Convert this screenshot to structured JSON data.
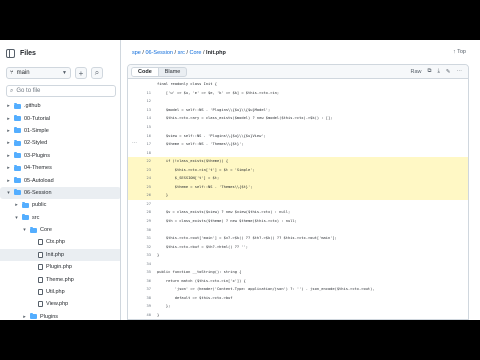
{
  "sidebar": {
    "title": "Files",
    "branch": "main",
    "search_placeholder": "Go to file",
    "tree": [
      {
        "label": ".github",
        "kind": "folder",
        "depth": 0,
        "expanded": false
      },
      {
        "label": "00-Tutorial",
        "kind": "folder",
        "depth": 0,
        "expanded": false
      },
      {
        "label": "01-Simple",
        "kind": "folder",
        "depth": 0,
        "expanded": false
      },
      {
        "label": "02-Styled",
        "kind": "folder",
        "depth": 0,
        "expanded": false
      },
      {
        "label": "03-Plugins",
        "kind": "folder",
        "depth": 0,
        "expanded": false
      },
      {
        "label": "04-Themes",
        "kind": "folder",
        "depth": 0,
        "expanded": false
      },
      {
        "label": "05-Autoload",
        "kind": "folder",
        "depth": 0,
        "expanded": false
      },
      {
        "label": "06-Session",
        "kind": "folder",
        "depth": 0,
        "expanded": true,
        "active": true
      },
      {
        "label": "public",
        "kind": "folder",
        "depth": 1,
        "expanded": false
      },
      {
        "label": "src",
        "kind": "folder",
        "depth": 1,
        "expanded": true
      },
      {
        "label": "Core",
        "kind": "folder",
        "depth": 2,
        "expanded": true
      },
      {
        "label": "Ctx.php",
        "kind": "file",
        "depth": 3
      },
      {
        "label": "Init.php",
        "kind": "file",
        "depth": 3,
        "selected": true
      },
      {
        "label": "Plugin.php",
        "kind": "file",
        "depth": 3
      },
      {
        "label": "Theme.php",
        "kind": "file",
        "depth": 3
      },
      {
        "label": "Util.php",
        "kind": "file",
        "depth": 3
      },
      {
        "label": "View.php",
        "kind": "file",
        "depth": 3
      },
      {
        "label": "Plugins",
        "kind": "folder",
        "depth": 2,
        "expanded": false
      }
    ]
  },
  "breadcrumb": {
    "parts": [
      "spe",
      "06-Session",
      "src",
      "Core"
    ],
    "current": "Init.php",
    "top_label": "Top"
  },
  "file_header": {
    "tab_code": "Code",
    "tab_blame": "Blame",
    "raw_label": "Raw"
  },
  "code": [
    {
      "n": "",
      "t": "final readonly class Init {"
    },
    {
      "n": "11",
      "t": "    ['u' => $u, 'e' => $e, 'k' => $k] = $this->ctx->in;"
    },
    {
      "n": "12",
      "t": ""
    },
    {
      "n": "13",
      "t": "    $model = self::NS . 'Plugins\\\\{$u}\\\\{$u}Model';"
    },
    {
      "n": "14",
      "t": "    $this->ctx->ary = class_exists($model) ? new $model($this->ctx)->$k() : [];"
    },
    {
      "n": "15",
      "t": ""
    },
    {
      "n": "16",
      "t": "    $view = self::NS . 'Plugins\\\\{$u}\\\\{$u}View';"
    },
    {
      "n": "17",
      "t": "    $theme = self::NS . 'Themes\\\\{$t}';"
    },
    {
      "n": "18",
      "t": ""
    },
    {
      "n": "22",
      "t": "    if (!class_exists($theme)) {",
      "hl": true
    },
    {
      "n": "23",
      "t": "        $this->ctx->in['t'] = $t = 'Simple';",
      "hl": true
    },
    {
      "n": "24",
      "t": "        $_SESSION['t'] = $t;",
      "hl": true
    },
    {
      "n": "25",
      "t": "        $theme = self::NS . 'Themes\\\\{$t}';",
      "hl": true
    },
    {
      "n": "26",
      "t": "    }",
      "hl": true
    },
    {
      "n": "27",
      "t": ""
    },
    {
      "n": "28",
      "t": "    $v = class_exists($view) ? new $view($this->ctx) : null;"
    },
    {
      "n": "29",
      "t": "    $th = class_exists($theme) ? new $theme($this->ctx) : null;"
    },
    {
      "n": "30",
      "t": ""
    },
    {
      "n": "31",
      "t": "    $this->ctx->out['main'] = $v?->$k() ?? $th?->$k() ?? $this->ctx->out['main'];"
    },
    {
      "n": "32",
      "t": "    $this->ctx->buf = $th?->html() ?? '';"
    },
    {
      "n": "33",
      "t": "}"
    },
    {
      "n": "34",
      "t": ""
    },
    {
      "n": "35",
      "t": "public function __toString(): string {"
    },
    {
      "n": "36",
      "t": "    return match ($this->ctx->in['x']) {"
    },
    {
      "n": "37",
      "t": "        'json' => (header('Content-Type: application/json') ?: '') . json_encode($this->ctx->out),"
    },
    {
      "n": "38",
      "t": "        default => $this->ctx->buf"
    },
    {
      "n": "39",
      "t": "    };"
    },
    {
      "n": "40",
      "t": "}"
    },
    {
      "n": "41",
      "t": "}"
    }
  ]
}
